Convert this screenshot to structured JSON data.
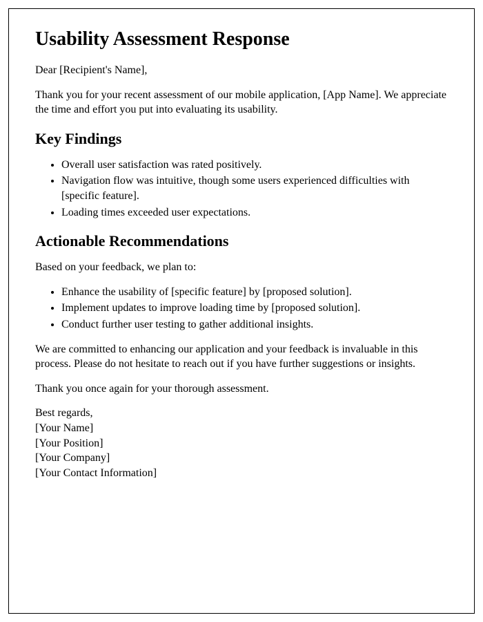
{
  "title": "Usability Assessment Response",
  "greeting": "Dear [Recipient's Name],",
  "intro": "Thank you for your recent assessment of our mobile application, [App Name]. We appreciate the time and effort you put into evaluating its usability.",
  "findings_heading": "Key Findings",
  "findings": [
    "Overall user satisfaction was rated positively.",
    "Navigation flow was intuitive, though some users experienced difficulties with [specific feature].",
    "Loading times exceeded user expectations."
  ],
  "recommendations_heading": "Actionable Recommendations",
  "recommendations_intro": "Based on your feedback, we plan to:",
  "recommendations": [
    "Enhance the usability of [specific feature] by [proposed solution].",
    "Implement updates to improve loading time by [proposed solution].",
    "Conduct further user testing to gather additional insights."
  ],
  "commitment": "We are committed to enhancing our application and your feedback is invaluable in this process. Please do not hesitate to reach out if you have further suggestions or insights.",
  "thanks": "Thank you once again for your thorough assessment.",
  "closing": "Best regards,",
  "signature": {
    "name": "[Your Name]",
    "position": "[Your Position]",
    "company": "[Your Company]",
    "contact": "[Your Contact Information]"
  }
}
